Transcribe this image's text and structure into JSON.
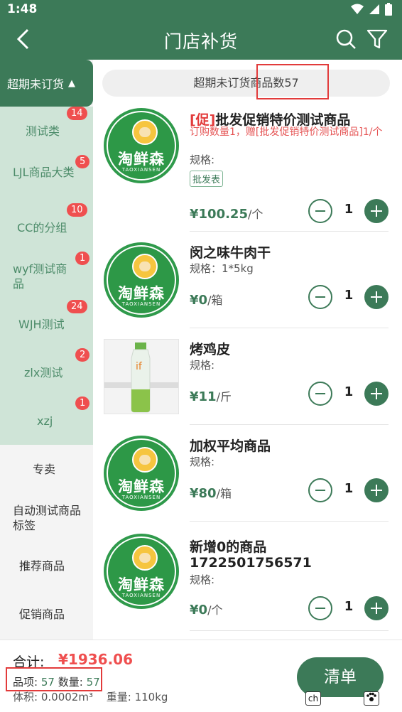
{
  "status_bar": {
    "time": "1:48"
  },
  "header": {
    "title": "门店补货"
  },
  "sidebar": {
    "active": {
      "label": "超期未订货",
      "caret": "▲"
    },
    "groups": [
      {
        "label": "测试类",
        "badge": "14"
      },
      {
        "label": "LJL商品大类",
        "badge": "5"
      },
      {
        "label": "CC的分组",
        "badge": "10"
      },
      {
        "label": "wyf测试商品",
        "badge": "1"
      },
      {
        "label": "WJH测试",
        "badge": "24"
      },
      {
        "label": "zlx测试",
        "badge": "2"
      },
      {
        "label": "xzj",
        "badge": "1"
      }
    ],
    "others": [
      {
        "label": "专卖"
      },
      {
        "label": "自动测试商品标签"
      },
      {
        "label": "推荐商品"
      },
      {
        "label": "促销商品"
      }
    ]
  },
  "count_bar": {
    "text": "超期未订货商品数57"
  },
  "products": [
    {
      "tag": "[促]",
      "name": "批发促销特价测试商品",
      "promo": "订购数量1，赠[批发促销特价测试商品]1/个",
      "spec": "规格:",
      "pill": "批发表",
      "price": "¥100.25",
      "unit": "/个",
      "qty": "1",
      "image": "brand-logo",
      "brand": "淘鲜森",
      "brand_sub": "TAOXIANSEN"
    },
    {
      "name": "闵之味牛肉干",
      "spec": "规格：1*5kg",
      "price": "¥0",
      "unit": "/箱",
      "qty": "1",
      "image": "brand-logo",
      "brand": "淘鲜森",
      "brand_sub": "TAOXIANSEN"
    },
    {
      "name": "烤鸡皮",
      "spec": "规格:",
      "price": "¥11",
      "unit": "/斤",
      "qty": "1",
      "image": "bottle-photo"
    },
    {
      "name": "加权平均商品",
      "spec": "规格:",
      "price": "¥80",
      "unit": "/箱",
      "qty": "1",
      "image": "brand-logo",
      "brand": "淘鲜森",
      "brand_sub": "TAOXIANSEN"
    },
    {
      "name": "新增0的商品",
      "name2": "1722501756571",
      "spec": "规格:",
      "price": "¥0",
      "unit": "/个",
      "qty": "1",
      "image": "brand-logo",
      "brand": "淘鲜森",
      "brand_sub": "TAOXIANSEN"
    }
  ],
  "footer": {
    "total_label": "合计:",
    "total_value": "¥1936.06",
    "items_label": "品项:",
    "items_value": "57",
    "qty_label": "数量:",
    "qty_value": "57",
    "volume_label": "体积:",
    "volume_value": "0.0002m³",
    "weight_label": "重量:",
    "weight_value": "110kg",
    "checkout_label": "清单",
    "mini_left": "ch"
  },
  "colors": {
    "primary": "#3c7a58",
    "badge": "#ef4f4f",
    "highlight": "#e23b3b",
    "sidebar_group_bg": "#cfe4d7"
  }
}
